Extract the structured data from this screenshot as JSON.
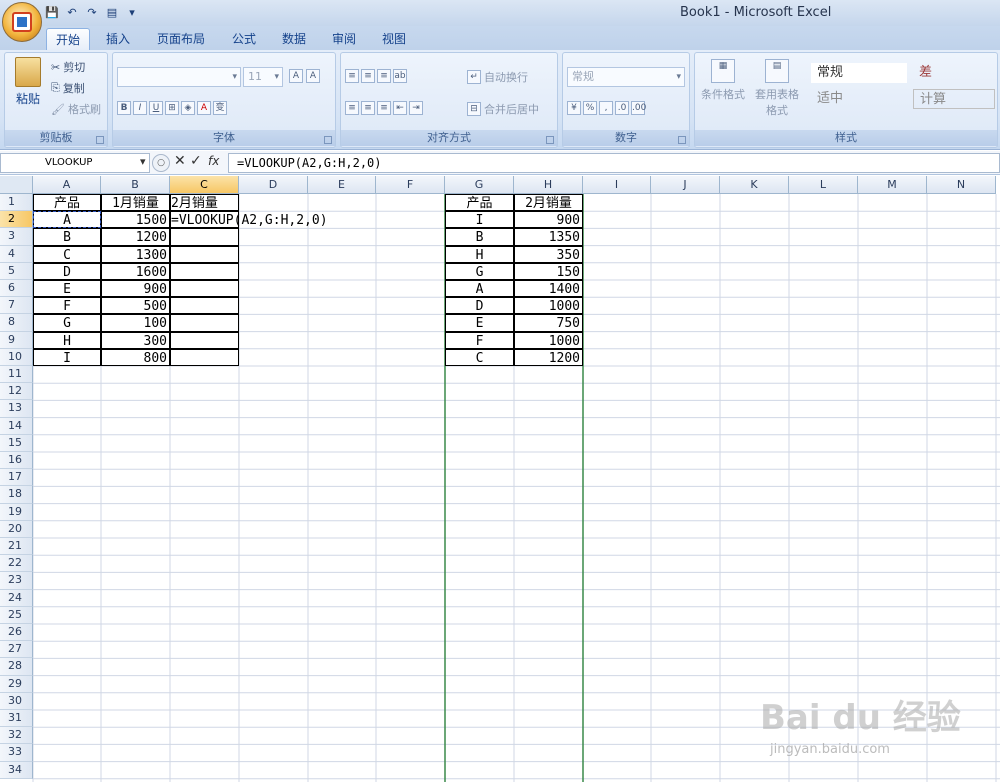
{
  "window": {
    "title": "Book1 - Microsoft Excel"
  },
  "tabs": [
    "开始",
    "插入",
    "页面布局",
    "公式",
    "数据",
    "审阅",
    "视图"
  ],
  "ribbon": {
    "clipboard": {
      "label": "剪贴板",
      "paste": "粘贴",
      "cut": "剪切",
      "copy": "复制",
      "format_painter": "格式刷"
    },
    "font": {
      "label": "字体",
      "size": "11"
    },
    "alignment": {
      "label": "对齐方式",
      "wrap_text": "自动换行",
      "merge_center": "合并后居中"
    },
    "number": {
      "label": "数字",
      "format": "常规"
    },
    "styles": {
      "label": "样式",
      "conditional_formatting": "条件格式",
      "format_as_table": "套用表格格式",
      "cell_styles": [
        "常规",
        "差",
        "适中",
        "计算"
      ]
    }
  },
  "formula_bar": {
    "name_box": "VLOOKUP",
    "fx": "fx",
    "formula": "=VLOOKUP(A2,G:H,2,0)"
  },
  "columns": [
    "A",
    "B",
    "C",
    "D",
    "E",
    "F",
    "G",
    "H",
    "I",
    "J",
    "K",
    "L",
    "M",
    "N"
  ],
  "rows": [
    "1",
    "2",
    "3",
    "4",
    "5",
    "6",
    "7",
    "8",
    "9",
    "10",
    "11",
    "12",
    "13",
    "14",
    "15",
    "16",
    "17",
    "18",
    "19",
    "20",
    "21",
    "22",
    "23",
    "24",
    "25",
    "26",
    "27",
    "28",
    "29",
    "30",
    "31",
    "32",
    "33",
    "34"
  ],
  "table1": {
    "headers": [
      "产品",
      "1月销量",
      "2月销量"
    ],
    "products": [
      "A",
      "B",
      "C",
      "D",
      "E",
      "F",
      "G",
      "H",
      "I"
    ],
    "jan_sales": [
      "1500",
      "1200",
      "1300",
      "1600",
      "900",
      "500",
      "100",
      "300",
      "800"
    ],
    "editing_cell": "=VLOOKUP(A2,G:H,2,0)"
  },
  "table2": {
    "headers": [
      "产品",
      "2月销量"
    ],
    "products": [
      "I",
      "B",
      "H",
      "G",
      "A",
      "D",
      "E",
      "F",
      "C"
    ],
    "feb_sales": [
      "900",
      "1350",
      "350",
      "150",
      "1400",
      "1000",
      "750",
      "1000",
      "1200"
    ]
  },
  "watermark": {
    "main": "Bai du 经验",
    "sub": "jingyan.baidu.com"
  }
}
